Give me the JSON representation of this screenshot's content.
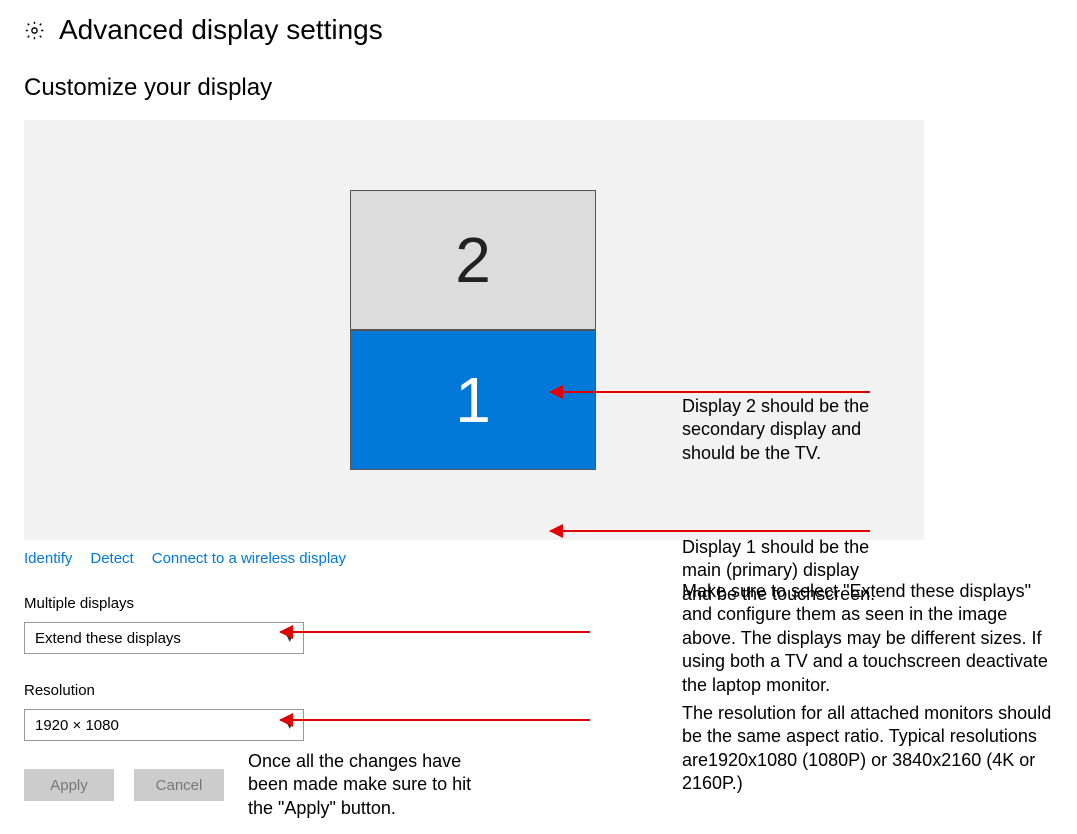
{
  "header": {
    "title": "Advanced display settings"
  },
  "sections": {
    "customize": "Customize your display"
  },
  "monitors": {
    "m2": "2",
    "m1": "1"
  },
  "links": {
    "identify": "Identify",
    "detect": "Detect",
    "wireless": "Connect to a wireless display"
  },
  "labels": {
    "multiple": "Multiple displays",
    "resolution": "Resolution"
  },
  "dropdowns": {
    "multiple_value": "Extend these displays",
    "resolution_value": "1920 × 1080"
  },
  "buttons": {
    "apply": "Apply",
    "cancel": "Cancel"
  },
  "annotations": {
    "disp2": "Display 2 should be the secondary display and should be the TV.",
    "disp1": "Display 1 should be the main (primary) display and be the touchscreen.",
    "extend": "Make sure to select \"Extend these displays\" and configure them as seen in the image above. The displays may be different sizes. If using both a TV and a touchscreen deactivate the laptop monitor.",
    "resolution": "The resolution for all attached monitors should be the same aspect ratio. Typical resolutions are1920x1080 (1080P) or 3840x2160 (4K or 2160P.)",
    "apply": "Once all the changes have been made make sure to hit the \"Apply\" button."
  }
}
